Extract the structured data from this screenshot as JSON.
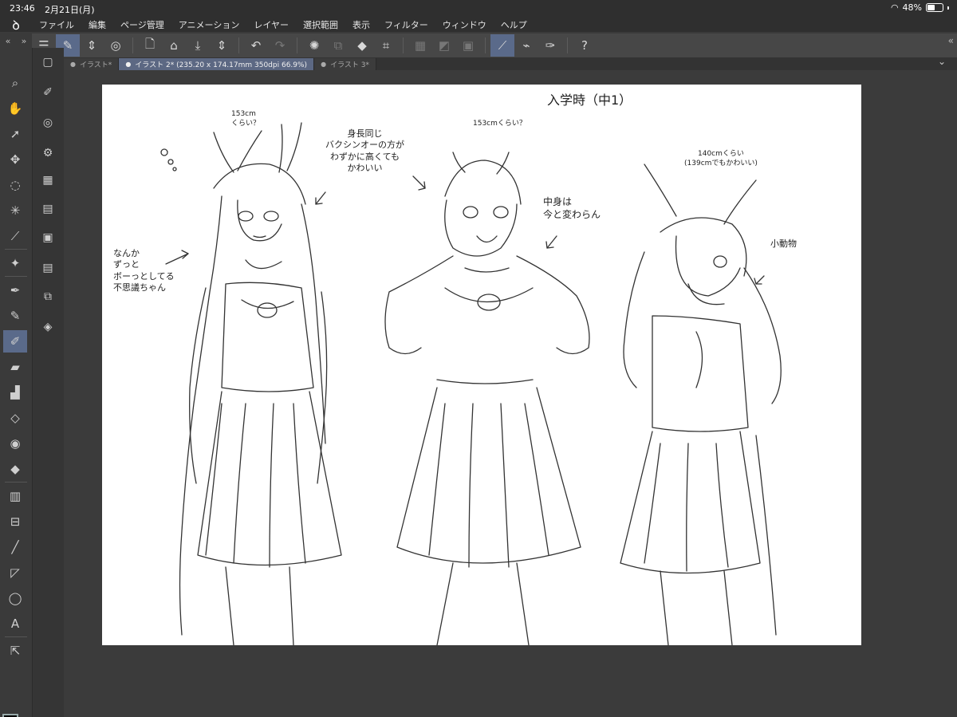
{
  "status": {
    "time": "23:46",
    "date": "2月21日(月)",
    "battery": "48%",
    "wifi_icon": "wifi-icon",
    "battery_icon": "battery-icon"
  },
  "menu": [
    "ファイル",
    "編集",
    "ページ管理",
    "アニメーション",
    "レイヤー",
    "選択範囲",
    "表示",
    "フィルター",
    "ウィンドウ",
    "ヘルプ"
  ],
  "tabs": [
    {
      "label": "イラスト*",
      "active": false
    },
    {
      "label": "イラスト 2* (235.20 x 174.17mm 350dpi 66.9%)",
      "active": true
    },
    {
      "label": "イラスト 3*",
      "active": false
    }
  ],
  "canvas_notes": {
    "title": "入学時（中1）",
    "h1": "153cm\nくらい？",
    "h2": "153cmくらい？",
    "h3": "140cmくらい\n(139cmでもかわいい)",
    "n_same": "身長同じ\nバクシンオーの方が\nわずかに高くても\nかわいい",
    "n_inside": "中身は\n今と変わらん",
    "n_small": "小動物",
    "n_left": "なんか\nずっと\nボーっとしてる\n不思議ちゃん"
  },
  "colors": {
    "accent": "#5a6a8a",
    "main_color": "#000000",
    "sub_color": "#ffffff"
  }
}
